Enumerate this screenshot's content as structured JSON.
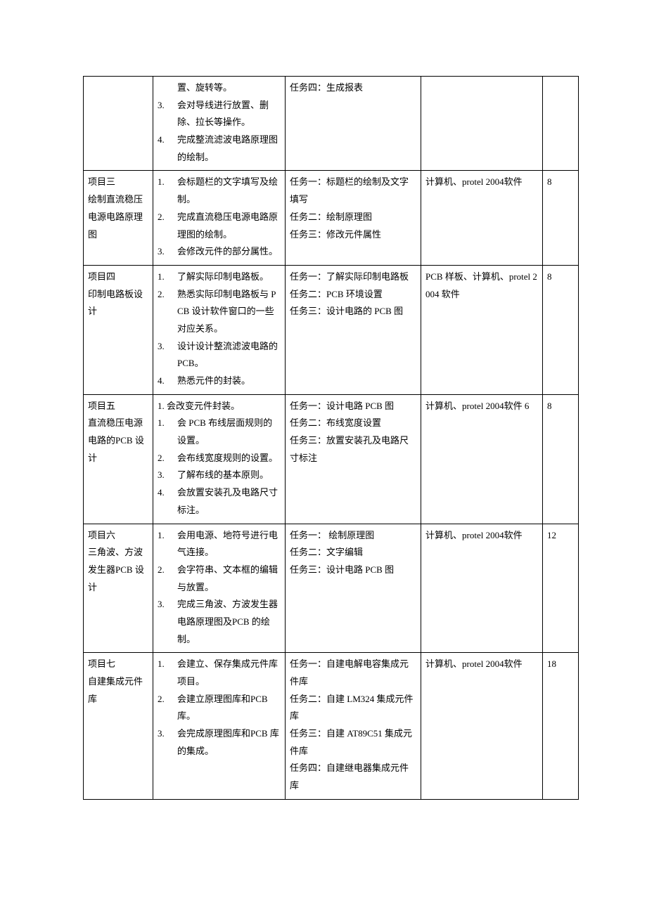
{
  "rows": [
    {
      "col1": "",
      "col2_start": "",
      "col2_items": [
        {
          "n": "",
          "t": "置、旋转等。"
        },
        {
          "n": "3.",
          "t": "会对导线进行放置、删除、拉长等操作。"
        },
        {
          "n": "4.",
          "t": "完成整流滤波电路原理图的绘制。"
        }
      ],
      "col3": "任务四：生成报表",
      "col4": "",
      "col5": ""
    },
    {
      "col1": "项目三\n绘制直流稳压电源电路原理图",
      "col2_items": [
        {
          "n": "1.",
          "t": "会标题栏的文字填写及绘制。"
        },
        {
          "n": "2.",
          "t": "完成直流稳压电源电路原理图的绘制。"
        },
        {
          "n": "3.",
          "t": "会修改元件的部分属性。"
        }
      ],
      "col3": "任务一：标题栏的绘制及文字填写\n任务二：绘制原理图\n任务三：修改元件属性",
      "col4": "计算机、protel 2004软件",
      "col5": "8"
    },
    {
      "col1": "项目四\n印制电路板设计",
      "col2_items": [
        {
          "n": "1.",
          "t": "了解实际印制电路板。"
        },
        {
          "n": "2.",
          "t": "熟悉实际印制电路板与 PCB 设计软件窗口的一些对应关系。"
        },
        {
          "n": "3.",
          "t": "设计设计整流滤波电路的 PCB。"
        },
        {
          "n": "4.",
          "t": "熟悉元件的封装。"
        }
      ],
      "col3": "任务一：了解实际印制电路板\n任务二：PCB 环境设置\n任务三：设计电路的 PCB 图",
      "col4": "PCB 样板、计算机、protel 2004 软件",
      "col5": "8"
    },
    {
      "col1": "项目五\n直流稳压电源电路的PCB 设计",
      "col2_start": "1. 会改变元件封装。",
      "col2_items": [
        {
          "n": "1.",
          "t": "会 PCB 布线层面规则的设置。"
        },
        {
          "n": "2.",
          "t": "会布线宽度规则的设置。"
        },
        {
          "n": "3.",
          "t": "了解布线的基本原则。"
        },
        {
          "n": "4.",
          "t": "会放置安装孔及电路尺寸标注。"
        }
      ],
      "col3": "任务一：设计电路 PCB 图\n任务二：布线宽度设置\n任务三：放置安装孔及电路尺寸标注",
      "col4": "计算机、protel 2004软件 6",
      "col5": "8"
    },
    {
      "col1": "项目六\n三角波、方波发生器PCB 设计",
      "col2_items": [
        {
          "n": "1.",
          "t": "会用电源、地符号进行电气连接。"
        },
        {
          "n": "2.",
          "t": "会字符串、文本框的编辑与放置。"
        },
        {
          "n": "3.",
          "t": "完成三角波、方波发生器电路原理图及PCB 的绘制。"
        }
      ],
      "col3": "任务一： 绘制原理图\n任务二：文字编辑\n任务三：设计电路 PCB 图",
      "col4": "计算机、protel 2004软件",
      "col5": "12"
    },
    {
      "col1": "项目七\n自建集成元件库",
      "col2_items": [
        {
          "n": "1.",
          "t": "会建立、保存集成元件库项目。"
        },
        {
          "n": "2.",
          "t": "会建立原理图库和PCB 库。"
        },
        {
          "n": "3.",
          "t": "会完成原理图库和PCB 库的集成。"
        }
      ],
      "col3": "任务一：自建电解电容集成元件库\n任务二：自建 LM324 集成元件库\n任务三：自建 AT89C51 集成元件库\n任务四：自建继电器集成元件库",
      "col4": "计算机、protel 2004软件",
      "col5": "18"
    }
  ]
}
